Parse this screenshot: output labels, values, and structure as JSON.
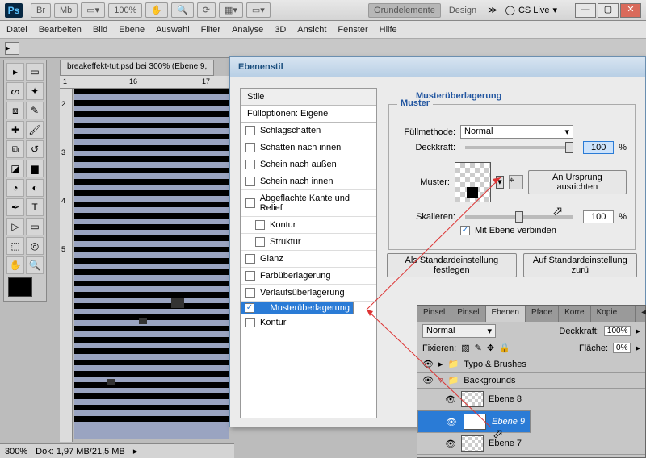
{
  "title": {
    "essentials": "Grundelemente",
    "design": "Design",
    "cslive": "CS Live"
  },
  "zoom": "100%",
  "menu": [
    "Datei",
    "Bearbeiten",
    "Bild",
    "Ebene",
    "Auswahl",
    "Filter",
    "Analyse",
    "3D",
    "Ansicht",
    "Fenster",
    "Hilfe"
  ],
  "doc_tab": "breakeffekt-tut.psd bei 300% (Ebene 9,",
  "ruler_h": [
    "1",
    "16",
    "17"
  ],
  "ruler_v": [
    "2",
    "3",
    "4",
    "5"
  ],
  "status": {
    "zoom": "300%",
    "docsize": "Dok: 1,97 MB/21,5 MB"
  },
  "dialog": {
    "title": "Ebenenstil",
    "stile_hdr": "Stile",
    "fill_opt": "Fülloptionen: Eigene",
    "items": [
      {
        "label": "Schlagschatten",
        "on": false
      },
      {
        "label": "Schatten nach innen",
        "on": false
      },
      {
        "label": "Schein nach außen",
        "on": false
      },
      {
        "label": "Schein nach innen",
        "on": false
      },
      {
        "label": "Abgeflachte Kante und Relief",
        "on": false
      },
      {
        "label": "Kontur",
        "on": false,
        "indent": true
      },
      {
        "label": "Struktur",
        "on": false,
        "indent": true
      },
      {
        "label": "Glanz",
        "on": false
      },
      {
        "label": "Farbüberlagerung",
        "on": false
      },
      {
        "label": "Verlaufsüberlagerung",
        "on": false
      },
      {
        "label": "Musterüberlagerung",
        "on": true,
        "sel": true
      },
      {
        "label": "Kontur",
        "on": false
      }
    ],
    "section_title": "Musterüberlagerung",
    "muster_hdr": "Muster",
    "blend_label": "Füllmethode:",
    "blend_val": "Normal",
    "opacity_label": "Deckkraft:",
    "opacity_val": "100",
    "pct": "%",
    "pattern_label": "Muster:",
    "snap_btn": "An Ursprung ausrichten",
    "scale_label": "Skalieren:",
    "scale_val": "100",
    "link_label": "Mit Ebene verbinden",
    "btn_default": "Als Standardeinstellung festlegen",
    "btn_reset": "Auf Standardeinstellung zurü"
  },
  "layers_panel": {
    "tabs": [
      "Pinsel",
      "Pinsel",
      "Ebenen",
      "Pfade",
      "Korre",
      "Kopie"
    ],
    "active_tab": 2,
    "mode": "Normal",
    "opacity_lbl": "Deckkraft:",
    "opacity_val": "100%",
    "lock_lbl": "Fixieren:",
    "fill_lbl": "Fläche:",
    "fill_val": "0%",
    "groups": [
      {
        "name": "Typo & Brushes"
      },
      {
        "name": "Backgrounds",
        "open": true
      }
    ],
    "layers": [
      {
        "name": "Ebene 8"
      },
      {
        "name": "Ebene 9",
        "sel": true
      },
      {
        "name": "Ebene 7"
      }
    ]
  },
  "chart_data": {
    "type": "table",
    "note": "not a chart"
  }
}
